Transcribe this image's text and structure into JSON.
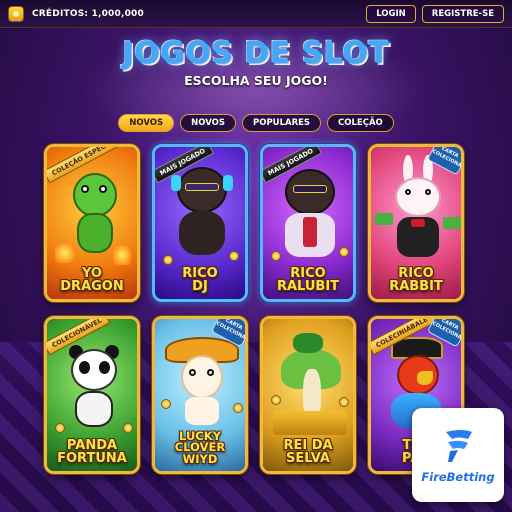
{
  "header": {
    "credits_label": "CRÉDITOS: 1,000,000",
    "login_label": "LOGIN",
    "register_label": "REGISTRE-SE"
  },
  "hero": {
    "title": "JOGOS DE SLOT",
    "subtitle": "ESCOLHA SEU JOGO!"
  },
  "tabs": [
    {
      "label": "NOVOS",
      "active": true
    },
    {
      "label": "NOVOS",
      "active": false
    },
    {
      "label": "POPULARES",
      "active": false
    },
    {
      "label": "COLEÇÃO",
      "active": false
    }
  ],
  "games": [
    {
      "name": "YO\nDRAGON",
      "line1": "YO",
      "line2": "DRAGON",
      "ribbon": "COLEÇÃO ESPECIAL"
    },
    {
      "name": "RICO DJ",
      "line1": "RICO",
      "line2": "DJ",
      "ribbon": "MAIS JOGADO"
    },
    {
      "name": "RICO RALUBIT",
      "line1": "RICO",
      "line2": "RALUBIT",
      "ribbon": "MAIS JOGADO"
    },
    {
      "name": "RICO RABBIT",
      "line1": "RICO",
      "line2": "RABBIT",
      "badge": "CARTA COLECIONÁVEL"
    },
    {
      "name": "PANDA FORTUNA",
      "line1": "PANDA",
      "line2": "FORTUNA",
      "ribbon": "COLECIONÁVEL"
    },
    {
      "name": "LUCKY CLOVER WIYD",
      "line1": "LUCKY",
      "line2": "CLOVER",
      "line3": "WIYD",
      "badge": "CARTA COLECIONÁVEL"
    },
    {
      "name": "REI DA SELVA",
      "line1": "REI DA",
      "line2": "SELVA"
    },
    {
      "name": "TESOURO PAPAGAIO",
      "line1": "TES",
      "line2": "PAP",
      "ribbon": "COLECINIÁBALE",
      "badge": "CARTA COLECIONÁVEL"
    }
  ],
  "sponsor": {
    "brand": "FireBetting"
  },
  "colors": {
    "accent_gold": "#f2b83a",
    "accent_blue": "#57b8ff",
    "brand_blue": "#1f6fe8"
  }
}
